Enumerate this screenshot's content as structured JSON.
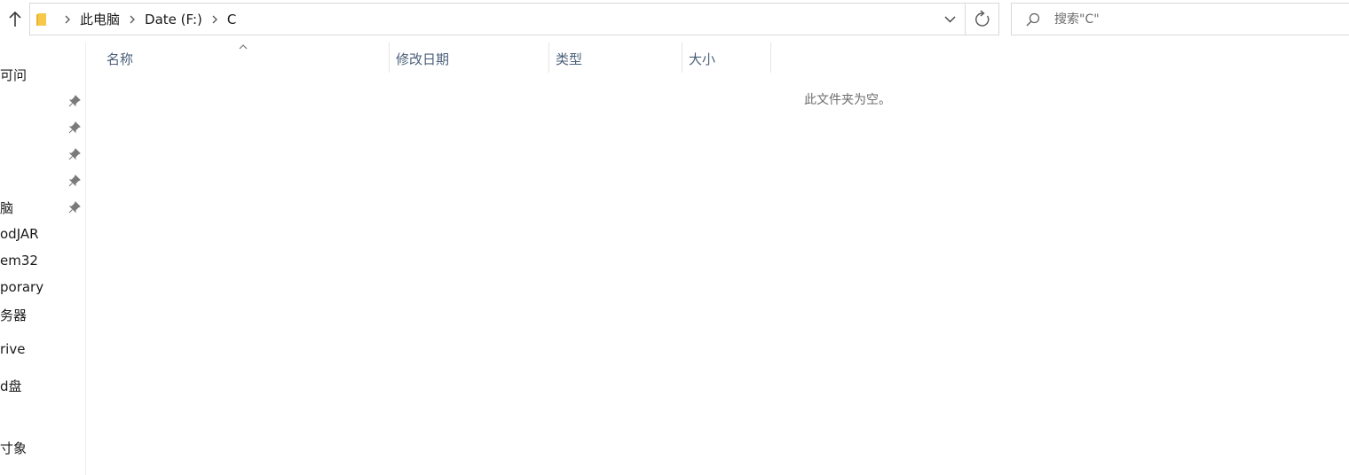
{
  "toolbar": {
    "up_icon": "arrow-up-icon"
  },
  "address_bar": {
    "folder_icon": "folder-icon",
    "breadcrumbs": [
      "此电脑",
      "Date (F:)",
      "C"
    ],
    "separator_icon": "chevron-right-icon",
    "dropdown_icon": "chevron-down-icon",
    "refresh_icon": "refresh-icon"
  },
  "search": {
    "placeholder": "搜索\"C\"",
    "icon": "search-icon"
  },
  "sidebar": {
    "items": [
      {
        "label": "可问",
        "pinned": false
      },
      {
        "label": "",
        "pinned": true
      },
      {
        "label": "",
        "pinned": true
      },
      {
        "label": "",
        "pinned": true
      },
      {
        "label": "",
        "pinned": true
      },
      {
        "label": "脑",
        "pinned": true
      },
      {
        "label": "odJAR",
        "pinned": false
      },
      {
        "label": "em32",
        "pinned": false
      },
      {
        "label": "porary",
        "pinned": false
      },
      {
        "label": "务器",
        "pinned": false
      },
      {
        "label": "rive",
        "pinned": false
      },
      {
        "label": "d盘",
        "pinned": false
      },
      {
        "label": "寸象",
        "pinned": false
      }
    ]
  },
  "columns": {
    "name": "名称",
    "modified": "修改日期",
    "type": "类型",
    "size": "大小",
    "sort_icon": "sort-ascending-icon"
  },
  "content": {
    "empty_message": "此文件夹为空。"
  },
  "colors": {
    "border": "#d9d9d9",
    "header_text": "#4c607a",
    "muted_text": "#6d6d6d",
    "folder_yellow": "#f7c948"
  }
}
